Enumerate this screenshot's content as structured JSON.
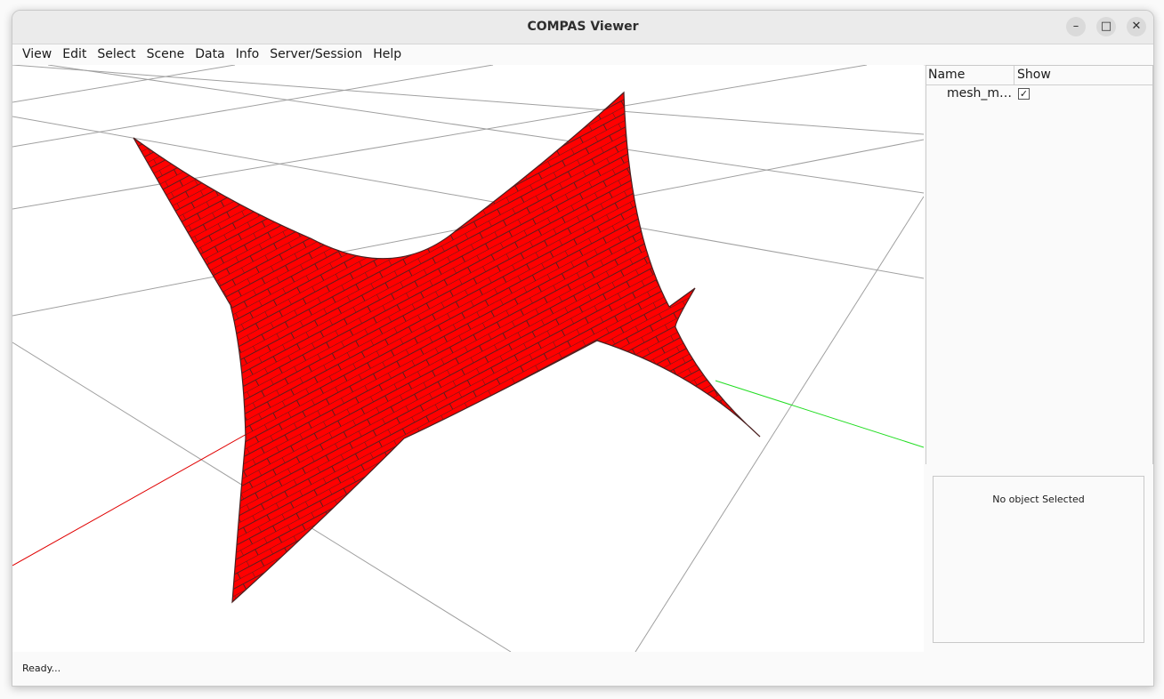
{
  "window": {
    "title": "COMPAS Viewer"
  },
  "window_controls": {
    "minimize": "–",
    "maximize": "□",
    "close": "✕"
  },
  "menu": {
    "items": [
      {
        "label": "View"
      },
      {
        "label": "Edit"
      },
      {
        "label": "Select"
      },
      {
        "label": "Scene"
      },
      {
        "label": "Data"
      },
      {
        "label": "Info"
      },
      {
        "label": "Server/Session"
      },
      {
        "label": "Help"
      }
    ]
  },
  "scene_tree": {
    "headers": {
      "name": "Name",
      "show": "Show"
    },
    "rows": [
      {
        "name": "mesh_m…",
        "show": true,
        "check_glyph": "✓"
      }
    ]
  },
  "properties": {
    "empty_message": "No object Selected"
  },
  "statusbar": {
    "text": "Ready..."
  },
  "colors": {
    "mesh_fill": "#ff0000",
    "mesh_edges": "#5a1e1e",
    "x_axis": "#e00000",
    "y_axis": "#22dd22",
    "grid": "#9a9a9a"
  }
}
